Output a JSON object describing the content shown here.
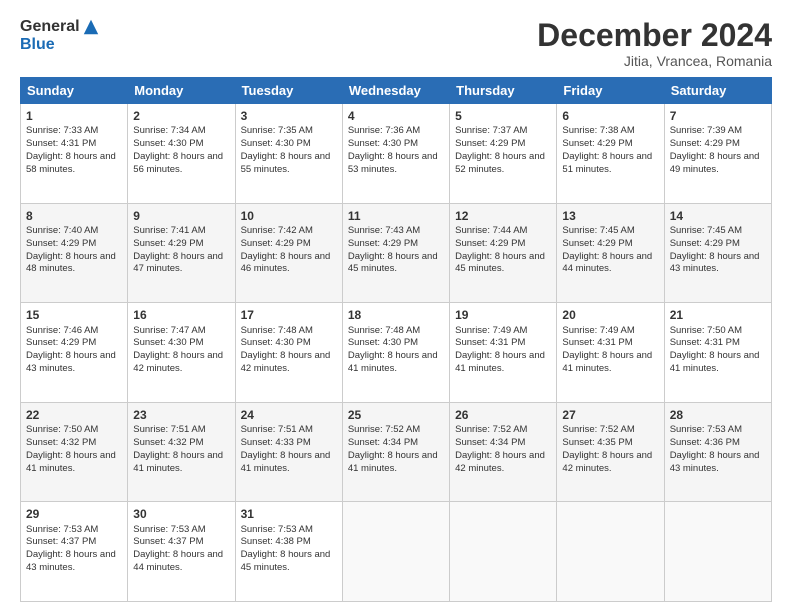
{
  "logo": {
    "general": "General",
    "blue": "Blue"
  },
  "header": {
    "month": "December 2024",
    "location": "Jitia, Vrancea, Romania"
  },
  "days": [
    "Sunday",
    "Monday",
    "Tuesday",
    "Wednesday",
    "Thursday",
    "Friday",
    "Saturday"
  ],
  "weeks": [
    [
      {
        "day": "1",
        "sunrise": "7:33 AM",
        "sunset": "4:31 PM",
        "daylight": "8 hours and 58 minutes."
      },
      {
        "day": "2",
        "sunrise": "7:34 AM",
        "sunset": "4:30 PM",
        "daylight": "8 hours and 56 minutes."
      },
      {
        "day": "3",
        "sunrise": "7:35 AM",
        "sunset": "4:30 PM",
        "daylight": "8 hours and 55 minutes."
      },
      {
        "day": "4",
        "sunrise": "7:36 AM",
        "sunset": "4:30 PM",
        "daylight": "8 hours and 53 minutes."
      },
      {
        "day": "5",
        "sunrise": "7:37 AM",
        "sunset": "4:29 PM",
        "daylight": "8 hours and 52 minutes."
      },
      {
        "day": "6",
        "sunrise": "7:38 AM",
        "sunset": "4:29 PM",
        "daylight": "8 hours and 51 minutes."
      },
      {
        "day": "7",
        "sunrise": "7:39 AM",
        "sunset": "4:29 PM",
        "daylight": "8 hours and 49 minutes."
      }
    ],
    [
      {
        "day": "8",
        "sunrise": "7:40 AM",
        "sunset": "4:29 PM",
        "daylight": "8 hours and 48 minutes."
      },
      {
        "day": "9",
        "sunrise": "7:41 AM",
        "sunset": "4:29 PM",
        "daylight": "8 hours and 47 minutes."
      },
      {
        "day": "10",
        "sunrise": "7:42 AM",
        "sunset": "4:29 PM",
        "daylight": "8 hours and 46 minutes."
      },
      {
        "day": "11",
        "sunrise": "7:43 AM",
        "sunset": "4:29 PM",
        "daylight": "8 hours and 45 minutes."
      },
      {
        "day": "12",
        "sunrise": "7:44 AM",
        "sunset": "4:29 PM",
        "daylight": "8 hours and 45 minutes."
      },
      {
        "day": "13",
        "sunrise": "7:45 AM",
        "sunset": "4:29 PM",
        "daylight": "8 hours and 44 minutes."
      },
      {
        "day": "14",
        "sunrise": "7:45 AM",
        "sunset": "4:29 PM",
        "daylight": "8 hours and 43 minutes."
      }
    ],
    [
      {
        "day": "15",
        "sunrise": "7:46 AM",
        "sunset": "4:29 PM",
        "daylight": "8 hours and 43 minutes."
      },
      {
        "day": "16",
        "sunrise": "7:47 AM",
        "sunset": "4:30 PM",
        "daylight": "8 hours and 42 minutes."
      },
      {
        "day": "17",
        "sunrise": "7:48 AM",
        "sunset": "4:30 PM",
        "daylight": "8 hours and 42 minutes."
      },
      {
        "day": "18",
        "sunrise": "7:48 AM",
        "sunset": "4:30 PM",
        "daylight": "8 hours and 41 minutes."
      },
      {
        "day": "19",
        "sunrise": "7:49 AM",
        "sunset": "4:31 PM",
        "daylight": "8 hours and 41 minutes."
      },
      {
        "day": "20",
        "sunrise": "7:49 AM",
        "sunset": "4:31 PM",
        "daylight": "8 hours and 41 minutes."
      },
      {
        "day": "21",
        "sunrise": "7:50 AM",
        "sunset": "4:31 PM",
        "daylight": "8 hours and 41 minutes."
      }
    ],
    [
      {
        "day": "22",
        "sunrise": "7:50 AM",
        "sunset": "4:32 PM",
        "daylight": "8 hours and 41 minutes."
      },
      {
        "day": "23",
        "sunrise": "7:51 AM",
        "sunset": "4:32 PM",
        "daylight": "8 hours and 41 minutes."
      },
      {
        "day": "24",
        "sunrise": "7:51 AM",
        "sunset": "4:33 PM",
        "daylight": "8 hours and 41 minutes."
      },
      {
        "day": "25",
        "sunrise": "7:52 AM",
        "sunset": "4:34 PM",
        "daylight": "8 hours and 41 minutes."
      },
      {
        "day": "26",
        "sunrise": "7:52 AM",
        "sunset": "4:34 PM",
        "daylight": "8 hours and 42 minutes."
      },
      {
        "day": "27",
        "sunrise": "7:52 AM",
        "sunset": "4:35 PM",
        "daylight": "8 hours and 42 minutes."
      },
      {
        "day": "28",
        "sunrise": "7:53 AM",
        "sunset": "4:36 PM",
        "daylight": "8 hours and 43 minutes."
      }
    ],
    [
      {
        "day": "29",
        "sunrise": "7:53 AM",
        "sunset": "4:37 PM",
        "daylight": "8 hours and 43 minutes."
      },
      {
        "day": "30",
        "sunrise": "7:53 AM",
        "sunset": "4:37 PM",
        "daylight": "8 hours and 44 minutes."
      },
      {
        "day": "31",
        "sunrise": "7:53 AM",
        "sunset": "4:38 PM",
        "daylight": "8 hours and 45 minutes."
      },
      null,
      null,
      null,
      null
    ]
  ]
}
